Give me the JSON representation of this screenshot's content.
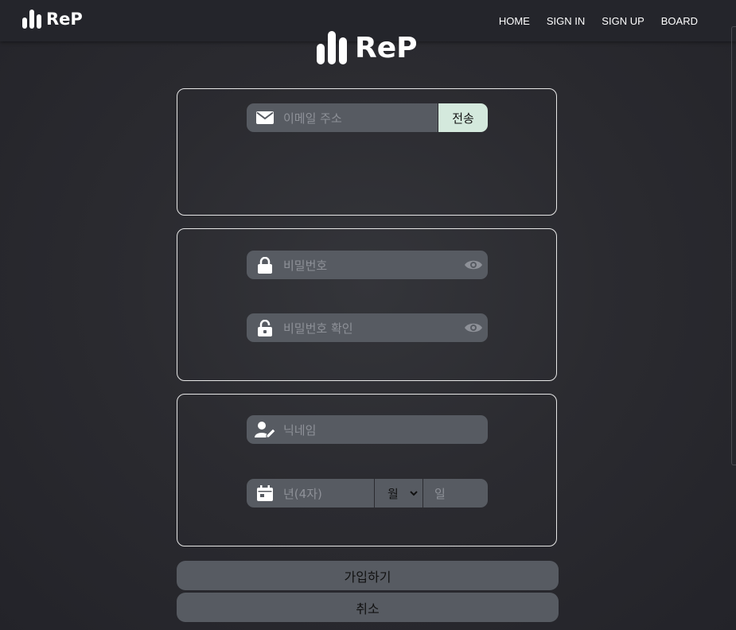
{
  "nav": {
    "logo": "ReP",
    "links": [
      "HOME",
      "SIGN IN",
      "SIGN UP",
      "BOARD"
    ]
  },
  "main_logo": "ReP",
  "email": {
    "placeholder": "이메일 주소",
    "send_label": "전송",
    "icon": "envelope-icon"
  },
  "password": {
    "placeholder": "비밀번호",
    "icon": "lock-icon",
    "toggle_icon": "eye-icon"
  },
  "password_confirm": {
    "placeholder": "비밀번호 확인",
    "icon": "unlock-icon",
    "toggle_icon": "eye-icon"
  },
  "nickname": {
    "placeholder": "닉네임",
    "icon": "user-pen-icon"
  },
  "birth": {
    "year_placeholder": "년(4자)",
    "month_value": "월",
    "day_placeholder": "일",
    "icon": "calendar-icon"
  },
  "buttons": {
    "signup": "가입하기",
    "cancel": "취소"
  },
  "colors": {
    "background": "#2b2b30",
    "input_bg": "#575b62",
    "send_bg": "#d4e9dd",
    "border": "#e6e6e6"
  }
}
